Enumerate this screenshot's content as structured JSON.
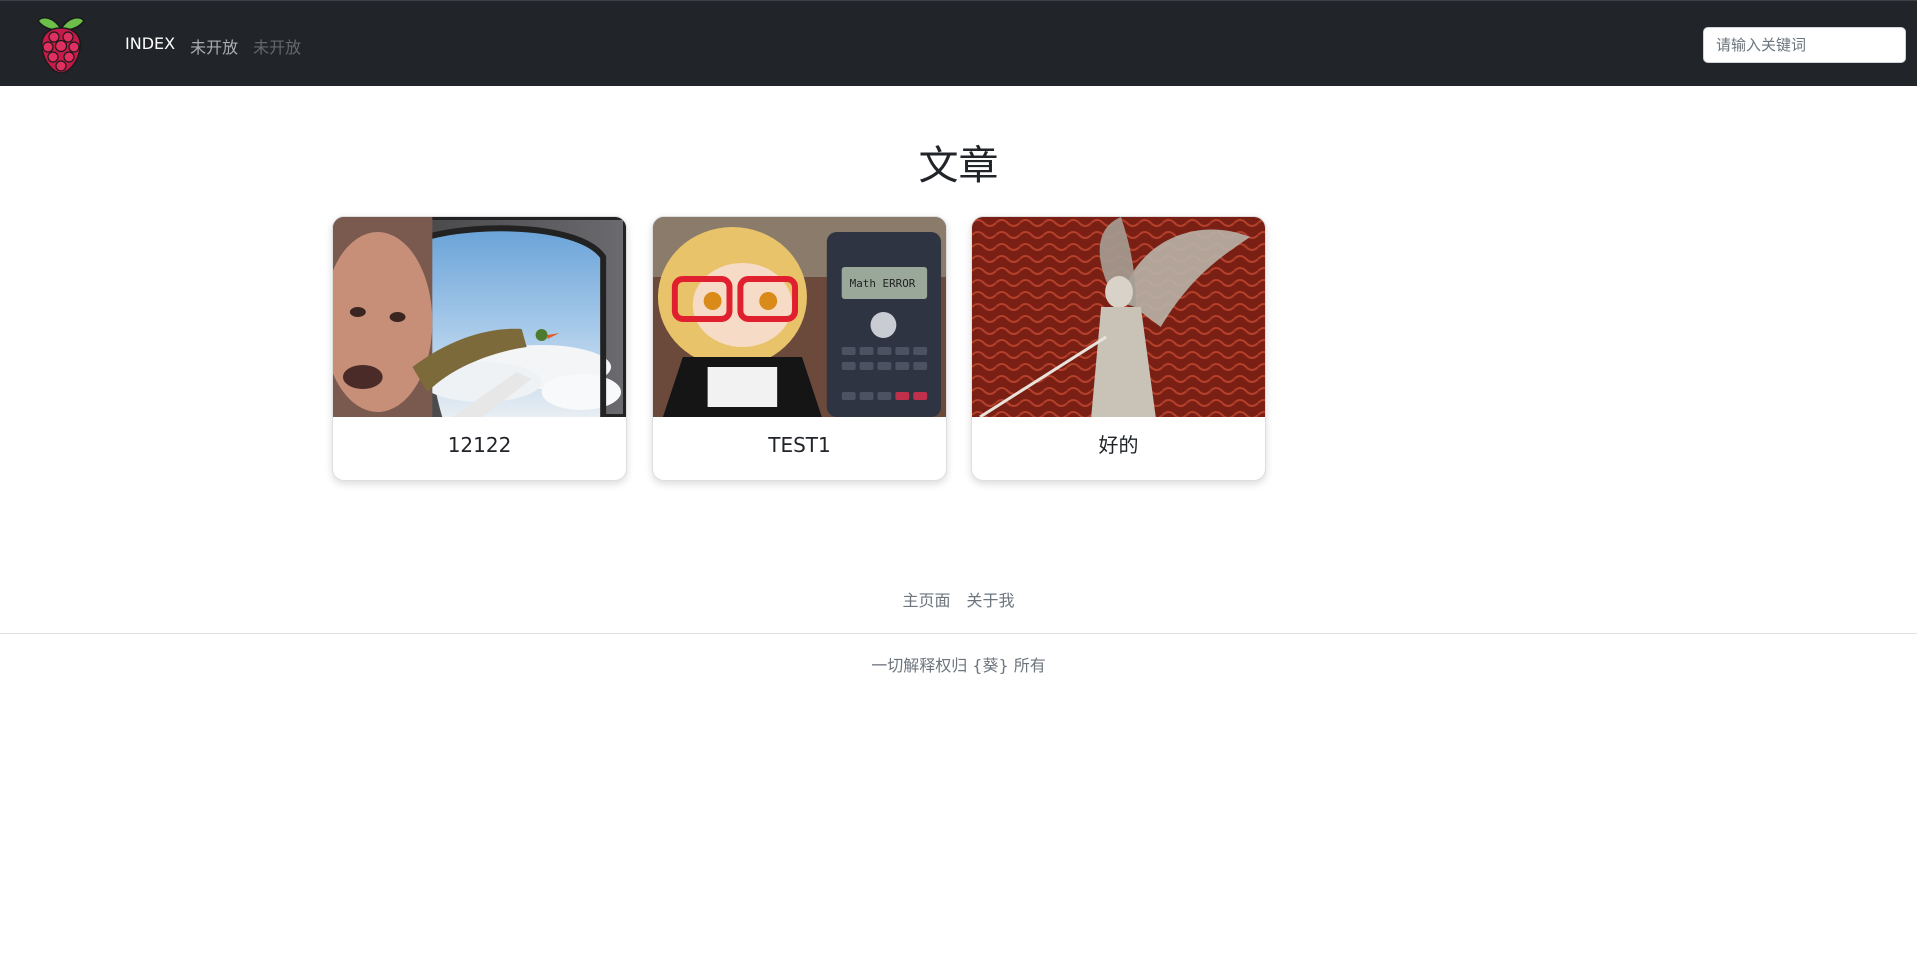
{
  "navbar": {
    "logo_icon": "raspberry-icon",
    "links": [
      {
        "label": "INDEX",
        "state": "active"
      },
      {
        "label": "未开放",
        "state": "normal"
      },
      {
        "label": "未开放",
        "state": "disabled"
      }
    ],
    "search": {
      "placeholder": "请输入关键词",
      "value": ""
    }
  },
  "main": {
    "title": "文章",
    "cards": [
      {
        "title": "12122",
        "image": "man-pointing-out-airplane-window-photo"
      },
      {
        "title": "TEST1",
        "image": "plush-doll-with-calculator-math-error-photo"
      },
      {
        "title": "好的",
        "image": "winged-angel-with-sword-illustration"
      }
    ]
  },
  "footer": {
    "links": [
      {
        "label": "主页面"
      },
      {
        "label": "关于我"
      }
    ],
    "copyright": "一切解释权归 {葵} 所有"
  },
  "colors": {
    "navbar_bg": "#212529",
    "text": "#212529",
    "muted": "#6c757d",
    "raspberry_red": "#c51a4a",
    "raspberry_leaf": "#6cc04a"
  }
}
